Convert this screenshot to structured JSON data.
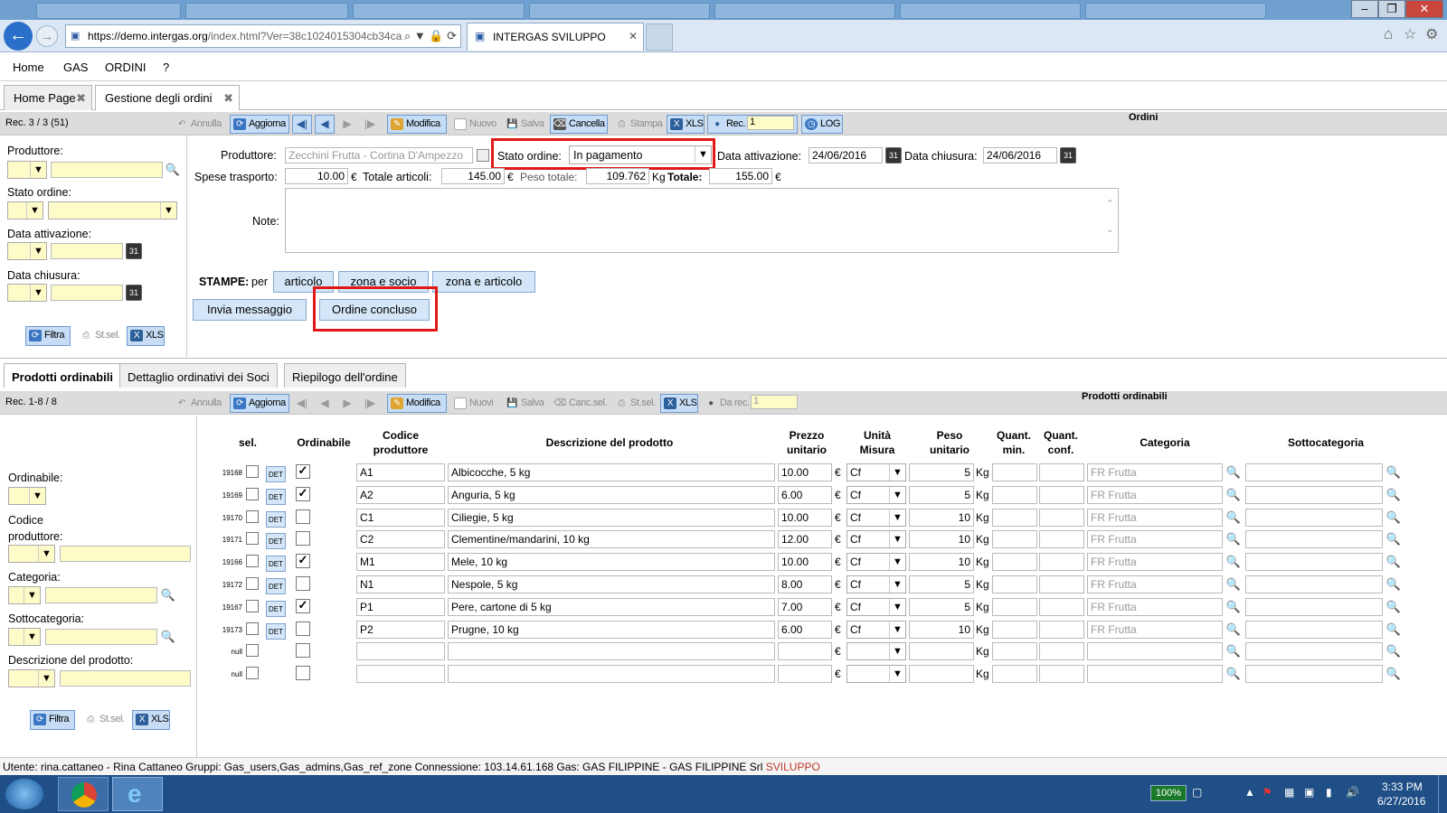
{
  "browser": {
    "url_domain": "https://demo.intergas.org",
    "url_rest": "/index.html?Ver=38c1024015304cb34ca",
    "tab_title": "INTERGAS SVILUPPO"
  },
  "menu": [
    "Home",
    "GAS",
    "ORDINI",
    "?"
  ],
  "app_tabs": [
    {
      "label": "Home Page"
    },
    {
      "label": "Gestione degli ordini"
    }
  ],
  "toolbar1": {
    "rec": "Rec. 3 / 3 (51)",
    "annulla": "Annulla",
    "aggiorna": "Aggiorna",
    "modifica": "Modifica",
    "nuovo": "Nuovo",
    "salva": "Salva",
    "cancella": "Cancella",
    "stampa": "Stampa",
    "xls": "XLS",
    "rec_label": "Rec.",
    "rec_value": "1",
    "log": "LOG",
    "section": "Ordini"
  },
  "filter1": {
    "produttore": "Produttore:",
    "stato": "Stato ordine:",
    "data_att": "Data attivazione:",
    "data_chiu": "Data chiusura:",
    "filtra": "Filtra",
    "stsel": "St.sel.",
    "xls": "XLS"
  },
  "form": {
    "produttore_label": "Produttore:",
    "produttore_value": "Zecchini Frutta - Cortina D'Ampezzo",
    "stato_label": "Stato ordine:",
    "stato_value": "In pagamento",
    "data_att_label": "Data attivazione:",
    "data_att_value": "24/06/2016",
    "data_chiu_label": "Data chiusura:",
    "data_chiu_value": "24/06/2016",
    "spese_label": "Spese trasporto:",
    "spese_value": "10.00",
    "euro": "€",
    "totart_label": "Totale articoli:",
    "totart_value": "145.00",
    "peso_label": "Peso totale:",
    "peso_value": "109.762",
    "kg": "Kg",
    "tot_label": "Totale:",
    "tot_value": "155.00",
    "note_label": "Note:",
    "stampe_label": "STAMPE:",
    "per": "per",
    "btn_articolo": "articolo",
    "btn_zona_socio": "zona e socio",
    "btn_zona_articolo": "zona e articolo",
    "btn_invia": "Invia messaggio",
    "btn_concluso": "Ordine concluso"
  },
  "subtabs": [
    {
      "label": "Prodotti ordinabili"
    },
    {
      "label": "Dettaglio ordinativi dei Soci"
    },
    {
      "label": "Riepilogo dell'ordine"
    }
  ],
  "toolbar2": {
    "rec": "Rec. 1-8 / 8",
    "annulla": "Annulla",
    "aggiorna": "Aggiorna",
    "modifica": "Modifica",
    "nuovi": "Nuovi",
    "salva": "Salva",
    "cancsel": "Canc.sel.",
    "stsel": "St.sel.",
    "xls": "XLS",
    "darec": "Da rec.",
    "darec_value": "1",
    "section": "Prodotti ordinabili"
  },
  "filter2": {
    "ordinabile": "Ordinabile:",
    "codice": "Codice produttore:",
    "categoria": "Categoria:",
    "sottocategoria": "Sottocategoria:",
    "descrizione": "Descrizione del prodotto:",
    "filtra": "Filtra",
    "stsel": "St.sel.",
    "xls": "XLS"
  },
  "table": {
    "headers": {
      "sel": "sel.",
      "ordinabile": "Ordinabile",
      "codice": "Codice produttore",
      "descrizione": "Descrizione del prodotto",
      "prezzo": "Prezzo unitario",
      "unita": "Unità Misura",
      "peso": "Peso unitario",
      "qmin": "Quant. min.",
      "qconf": "Quant. conf.",
      "categoria": "Categoria",
      "sottocategoria": "Sottocategoria"
    },
    "det": "DET",
    "euro": "€",
    "kg": "Kg",
    "rows": [
      {
        "id": "19168",
        "ord": true,
        "code": "A1",
        "desc": "Albicocche, 5 kg",
        "price": "10.00",
        "um": "Cf",
        "weight": "5",
        "cat": "FR Frutta"
      },
      {
        "id": "19169",
        "ord": true,
        "code": "A2",
        "desc": "Anguria, 5 kg",
        "price": "6.00",
        "um": "Cf",
        "weight": "5",
        "cat": "FR Frutta"
      },
      {
        "id": "19170",
        "ord": false,
        "code": "C1",
        "desc": "Ciliegie, 5 kg",
        "price": "10.00",
        "um": "Cf",
        "weight": "10",
        "cat": "FR Frutta"
      },
      {
        "id": "19171",
        "ord": false,
        "code": "C2",
        "desc": "Clementine/mandarini, 10 kg",
        "price": "12.00",
        "um": "Cf",
        "weight": "10",
        "cat": "FR Frutta"
      },
      {
        "id": "19166",
        "ord": true,
        "code": "M1",
        "desc": "Mele, 10 kg",
        "price": "10.00",
        "um": "Cf",
        "weight": "10",
        "cat": "FR Frutta"
      },
      {
        "id": "19172",
        "ord": false,
        "code": "N1",
        "desc": "Nespole, 5 kg",
        "price": "8.00",
        "um": "Cf",
        "weight": "5",
        "cat": "FR Frutta"
      },
      {
        "id": "19167",
        "ord": true,
        "code": "P1",
        "desc": "Pere, cartone di 5 kg",
        "price": "7.00",
        "um": "Cf",
        "weight": "5",
        "cat": "FR Frutta"
      },
      {
        "id": "19173",
        "ord": false,
        "code": "P2",
        "desc": "Prugne, 10 kg",
        "price": "6.00",
        "um": "Cf",
        "weight": "10",
        "cat": "FR Frutta"
      },
      {
        "id": "null",
        "ord": false,
        "code": "",
        "desc": "",
        "price": "",
        "um": "",
        "weight": "",
        "cat": ""
      },
      {
        "id": "null",
        "ord": false,
        "code": "",
        "desc": "",
        "price": "",
        "um": "",
        "weight": "",
        "cat": ""
      }
    ]
  },
  "status": {
    "text": "Utente: rina.cattaneo - Rina Cattaneo    Gruppi: Gas_users,Gas_admins,Gas_ref_zone    Connessione: 103.14.61.168    Gas: GAS FILIPPINE - GAS FILIPPINE Srl",
    "env": "SVILUPPO",
    "env_color": "#c0392b"
  },
  "taskbar": {
    "battery": "100%",
    "time": "3:33 PM",
    "date": "6/27/2016"
  }
}
